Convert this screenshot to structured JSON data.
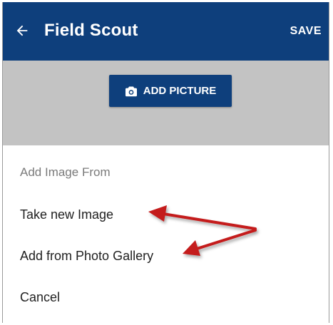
{
  "app_bar": {
    "title": "Field Scout",
    "save_label": "SAVE",
    "back_icon": "arrow-left-icon",
    "background": "#0e3f7c"
  },
  "content": {
    "add_picture_label": "ADD PICTURE",
    "add_picture_icon": "camera-icon",
    "scrim_color": "#c3c3c3"
  },
  "sheet": {
    "header": "Add Image From",
    "items": [
      {
        "label": "Take new Image"
      },
      {
        "label": "Add from Photo Gallery"
      },
      {
        "label": "Cancel"
      }
    ]
  },
  "annotation": {
    "arrow_color": "#c41a1a"
  }
}
